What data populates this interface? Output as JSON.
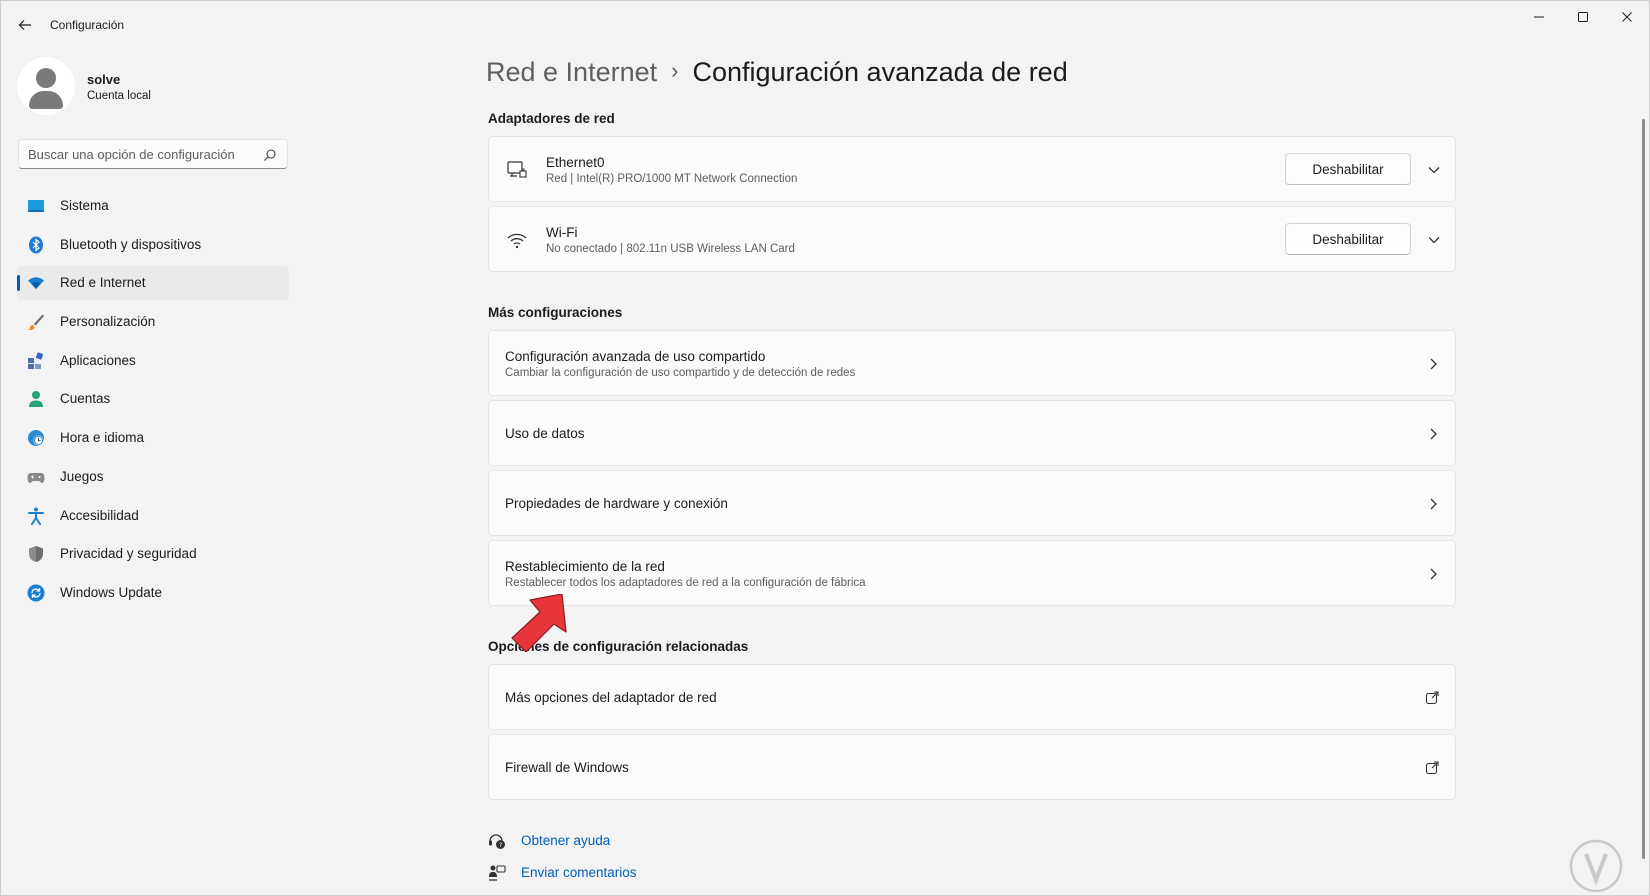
{
  "window": {
    "title": "Configuración"
  },
  "profile": {
    "name": "solve",
    "account_type": "Cuenta local"
  },
  "search": {
    "placeholder": "Buscar una opción de configuración"
  },
  "nav": [
    {
      "label": "Sistema",
      "icon": "system-icon",
      "active": false
    },
    {
      "label": "Bluetooth y dispositivos",
      "icon": "bluetooth-icon",
      "active": false
    },
    {
      "label": "Red e Internet",
      "icon": "wifi-icon",
      "active": true
    },
    {
      "label": "Personalización",
      "icon": "brush-icon",
      "active": false
    },
    {
      "label": "Aplicaciones",
      "icon": "apps-icon",
      "active": false
    },
    {
      "label": "Cuentas",
      "icon": "person-icon",
      "active": false
    },
    {
      "label": "Hora e idioma",
      "icon": "globe-clock-icon",
      "active": false
    },
    {
      "label": "Juegos",
      "icon": "gamepad-icon",
      "active": false
    },
    {
      "label": "Accesibilidad",
      "icon": "accessibility-icon",
      "active": false
    },
    {
      "label": "Privacidad y seguridad",
      "icon": "shield-icon",
      "active": false
    },
    {
      "label": "Windows Update",
      "icon": "update-icon",
      "active": false
    }
  ],
  "breadcrumb": {
    "parent": "Red e Internet",
    "separator": "›",
    "current": "Configuración avanzada de red"
  },
  "adapters": {
    "section_title": "Adaptadores de red",
    "items": [
      {
        "name": "Ethernet0",
        "detail": "Red | Intel(R) PRO/1000 MT Network Connection",
        "button": "Deshabilitar",
        "icon": "ethernet-icon"
      },
      {
        "name": "Wi-Fi",
        "detail": "No conectado | 802.11n USB Wireless LAN Card",
        "button": "Deshabilitar",
        "icon": "wifi-icon"
      }
    ]
  },
  "more": {
    "section_title": "Más configuraciones",
    "items": [
      {
        "title": "Configuración avanzada de uso compartido",
        "subtitle": "Cambiar la configuración de uso compartido y de detección de redes"
      },
      {
        "title": "Uso de datos",
        "subtitle": ""
      },
      {
        "title": "Propiedades de hardware y conexión",
        "subtitle": ""
      },
      {
        "title": "Restablecimiento de la red",
        "subtitle": "Restablecer todos los adaptadores de red a la configuración de fábrica"
      }
    ]
  },
  "related": {
    "section_title": "Opciones de configuración relacionadas",
    "items": [
      {
        "title": "Más opciones del adaptador de red"
      },
      {
        "title": "Firewall de Windows"
      }
    ]
  },
  "help_links": [
    {
      "label": "Obtener ayuda",
      "icon": "help-icon"
    },
    {
      "label": "Enviar comentarios",
      "icon": "feedback-icon"
    }
  ],
  "colors": {
    "accent": "#005fb8",
    "background": "#f3f3f3",
    "card": "#fbfbfb",
    "annotation_arrow": "#e8353b"
  }
}
